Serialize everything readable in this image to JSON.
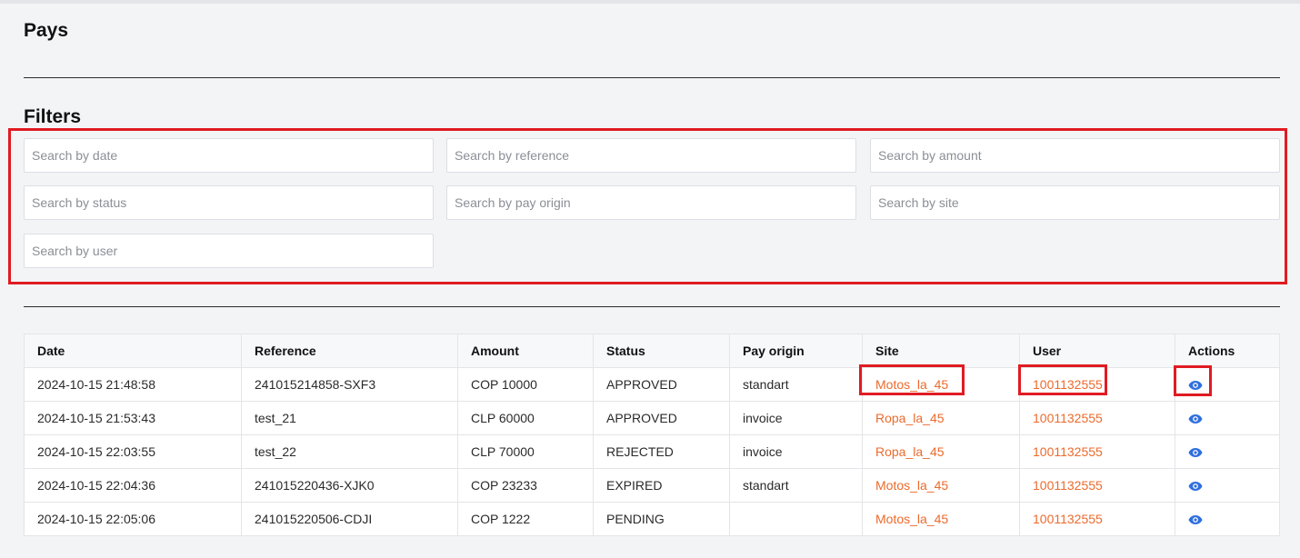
{
  "page": {
    "title": "Pays",
    "filters_title": "Filters"
  },
  "filters": [
    {
      "placeholder": "Search by date"
    },
    {
      "placeholder": "Search by reference"
    },
    {
      "placeholder": "Search by amount"
    },
    {
      "placeholder": "Search by status"
    },
    {
      "placeholder": "Search by pay origin"
    },
    {
      "placeholder": "Search by site"
    },
    {
      "placeholder": "Search by user"
    }
  ],
  "table": {
    "headers": [
      "Date",
      "Reference",
      "Amount",
      "Status",
      "Pay origin",
      "Site",
      "User",
      "Actions"
    ],
    "rows": [
      {
        "date": "2024-10-15 21:48:58",
        "reference": "241015214858-SXF3",
        "amount": "COP 10000",
        "status": "APPROVED",
        "origin": "standart",
        "site": "Motos_la_45",
        "user": "1001132555"
      },
      {
        "date": "2024-10-15 21:53:43",
        "reference": "test_21",
        "amount": "CLP 60000",
        "status": "APPROVED",
        "origin": "invoice",
        "site": "Ropa_la_45",
        "user": "1001132555"
      },
      {
        "date": "2024-10-15 22:03:55",
        "reference": "test_22",
        "amount": "CLP 70000",
        "status": "REJECTED",
        "origin": "invoice",
        "site": "Ropa_la_45",
        "user": "1001132555"
      },
      {
        "date": "2024-10-15 22:04:36",
        "reference": "241015220436-XJK0",
        "amount": "COP 23233",
        "status": "EXPIRED",
        "origin": "standart",
        "site": "Motos_la_45",
        "user": "1001132555"
      },
      {
        "date": "2024-10-15 22:05:06",
        "reference": "241015220506-CDJI",
        "amount": "COP 1222",
        "status": "PENDING",
        "origin": "",
        "site": "Motos_la_45",
        "user": "1001132555"
      }
    ]
  },
  "colors": {
    "link": "#ec6a2c",
    "eye_icon": "#2f6fde",
    "highlight": "#e01b22"
  },
  "icons": {
    "action": "eye-icon"
  }
}
